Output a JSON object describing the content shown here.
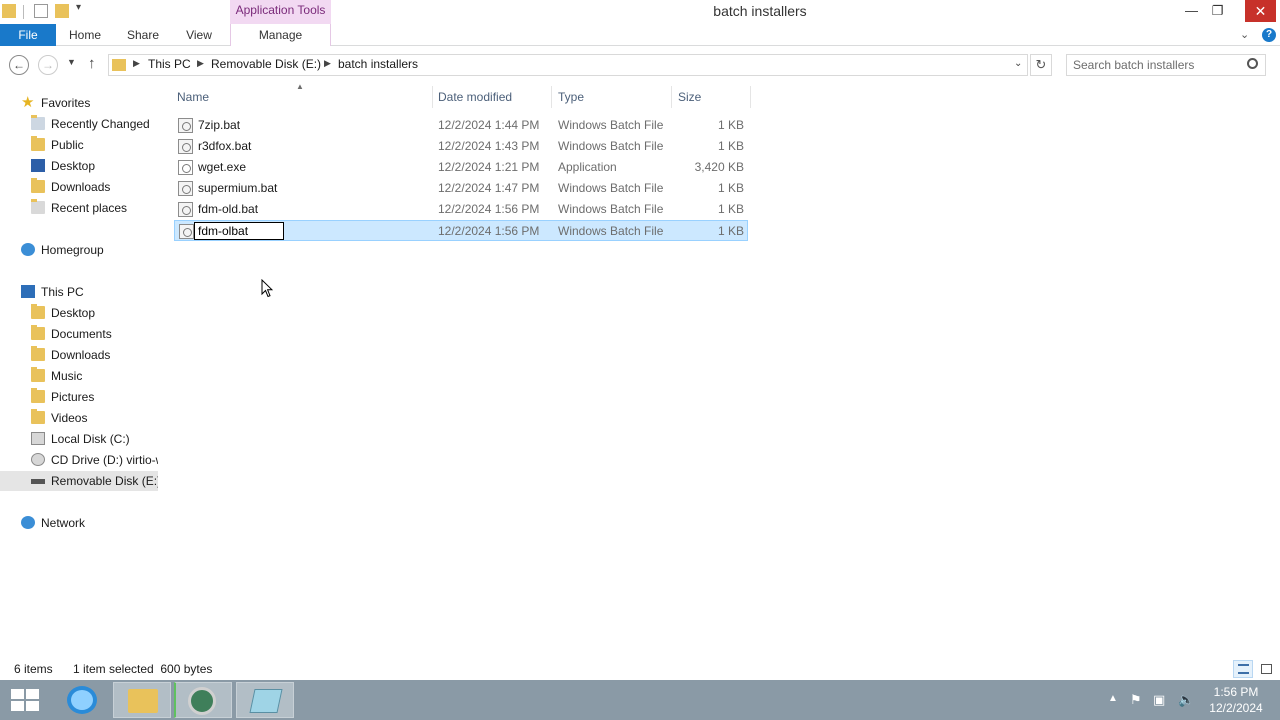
{
  "window": {
    "title": "batch installers",
    "context_tab": "Application Tools"
  },
  "window_controls": {
    "minimize": "—",
    "restore": "❐",
    "close": "✕"
  },
  "ribbon": {
    "tabs": [
      "File",
      "Home",
      "Share",
      "View",
      "Manage"
    ],
    "collapse_glyph": "⌄",
    "help_glyph": "?"
  },
  "address": {
    "crumbs": [
      "This PC",
      "Removable Disk (E:)",
      "batch installers"
    ],
    "search_placeholder": "Search batch installers"
  },
  "navpane": {
    "favorites_header": "Favorites",
    "favorites": [
      "Recently Changed",
      "Public",
      "Desktop",
      "Downloads",
      "Recent places"
    ],
    "homegroup": "Homegroup",
    "thispc_header": "This PC",
    "thispc_items": [
      "Desktop",
      "Documents",
      "Downloads",
      "Music",
      "Pictures",
      "Videos",
      "Local Disk (C:)",
      "CD Drive (D:) virtio-w",
      "Removable Disk (E:)"
    ],
    "network": "Network"
  },
  "filelist": {
    "columns": [
      "Name",
      "Date modified",
      "Type",
      "Size"
    ],
    "rows": [
      {
        "name": "7zip.bat",
        "date": "12/2/2024 1:44 PM",
        "type": "Windows Batch File",
        "size": "1 KB"
      },
      {
        "name": "r3dfox.bat",
        "date": "12/2/2024 1:43 PM",
        "type": "Windows Batch File",
        "size": "1 KB"
      },
      {
        "name": "wget.exe",
        "date": "12/2/2024 1:21 PM",
        "type": "Application",
        "size": "3,420 KB"
      },
      {
        "name": "supermium.bat",
        "date": "12/2/2024 1:47 PM",
        "type": "Windows Batch File",
        "size": "1 KB"
      },
      {
        "name": "fdm-old.bat",
        "date": "12/2/2024 1:56 PM",
        "type": "Windows Batch File",
        "size": "1 KB"
      },
      {
        "name": "fdm-olbat",
        "date": "12/2/2024 1:56 PM",
        "type": "Windows Batch File",
        "size": "1 KB",
        "selected": true,
        "renaming": true
      }
    ]
  },
  "status": {
    "items": "6 items",
    "selection": "1 item selected  600 bytes"
  },
  "taskbar": {
    "time": "1:56 PM",
    "date": "12/2/2024"
  },
  "colors": {
    "file_tab": "#1979ca",
    "context_tab_bg": "#f2d9f2",
    "selection_bg": "#cce8ff",
    "taskbar": "#8a9aa6",
    "close": "#c7312a"
  }
}
